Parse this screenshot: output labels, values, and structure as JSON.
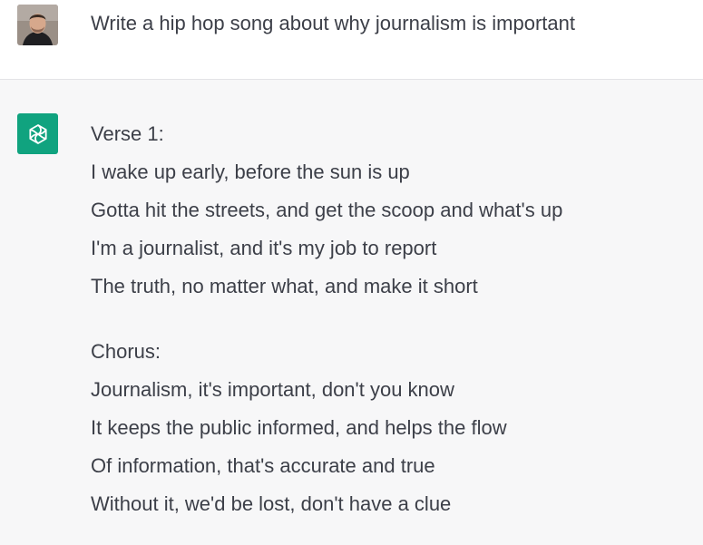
{
  "user_message": {
    "avatar_icon": "user-avatar-photo",
    "text": "Write a hip hop song about why journalism is important"
  },
  "assistant_message": {
    "icon": "openai-logo-icon",
    "icon_color": "#10a37f",
    "verse": {
      "heading": "Verse 1:",
      "lines": [
        "I wake up early, before the sun is up",
        "Gotta hit the streets, and get the scoop and what's up",
        "I'm a journalist, and it's my job to report",
        "The truth, no matter what, and make it short"
      ]
    },
    "chorus": {
      "heading": "Chorus:",
      "lines": [
        "Journalism, it's important, don't you know",
        "It keeps the public informed, and helps the flow",
        "Of information, that's accurate and true",
        "Without it, we'd be lost, don't have a clue"
      ]
    }
  }
}
